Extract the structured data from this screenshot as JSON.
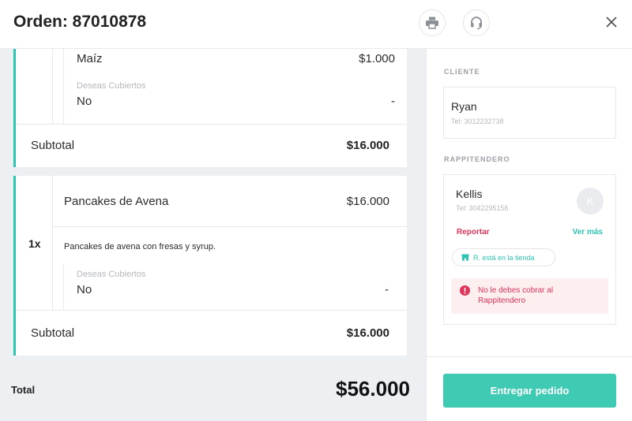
{
  "header": {
    "title": "Orden: 87010878",
    "print_icon": "printer-icon",
    "support_icon": "headset-icon",
    "close_icon": "close-icon"
  },
  "order": {
    "card1": {
      "item_name": "Maíz",
      "item_price": "$1.000",
      "option_label": "Deseas Cubiertos",
      "option_value": "No",
      "option_price": "-",
      "subtotal_label": "Subtotal",
      "subtotal_value": "$16.000"
    },
    "card2": {
      "quantity": "1x",
      "item_name": "Pancakes de Avena",
      "item_price": "$16.000",
      "description": "Pancakes de avena con fresas y syrup.",
      "option_label": "Deseas Cubiertos",
      "option_value": "No",
      "option_price": "-",
      "subtotal_label": "Subtotal",
      "subtotal_value": "$16.000"
    },
    "total_label": "Total",
    "total_value": "$56.000"
  },
  "sidebar": {
    "client_label": "CLIENTE",
    "client_name": "Ryan",
    "client_phone": "Tel: 3012232738",
    "courier_label": "RAPPITENDERO",
    "courier_name": "Kellis",
    "courier_phone": "Tel: 3042295156",
    "courier_initial": "K",
    "report_link": "Reportar",
    "more_link": "Ver más",
    "status_pill": "R. está en la tienda",
    "alert_text": "No le debes cobrar al Rappitendero",
    "deliver_button": "Entregar pedido"
  },
  "colors": {
    "accent": "#2fc4b2",
    "primary_button": "#3fcab3",
    "danger": "#e0345a",
    "alert_bg": "#fdeef0",
    "panel_bg": "#edf0f2"
  }
}
